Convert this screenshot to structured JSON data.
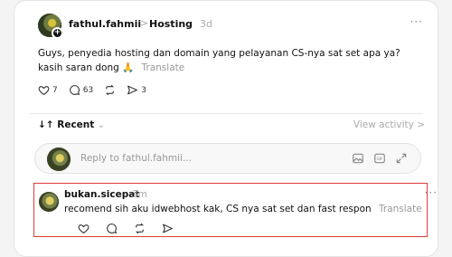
{
  "post": {
    "username": "fathul.fahmii",
    "separator": ">",
    "community": "Hosting",
    "time": "3d",
    "more": "···",
    "line1": "Guys, penyedia hosting dan domain yang pelayanan CS-nya sat set apa ya?",
    "line2": "kasih saran dong 🙏",
    "translate": "Translate",
    "likes": "7",
    "comments": "63",
    "shares": "3"
  },
  "sort": {
    "label": "↓↑ Recent",
    "caret": "⌄",
    "view_activity": "View activity >"
  },
  "reply": {
    "placeholder": "Reply to fathul.fahmii..."
  },
  "comment": {
    "username": "bukan.sicepat",
    "time": "3m",
    "text": "recomend sih aku idwebhost kak, CS nya sat set dan fast respon",
    "translate": "Translate",
    "more": "···"
  },
  "colors": {
    "highlight_border": "#e03a3a",
    "muted": "#aaaaaa"
  },
  "icons": [
    "heart-icon",
    "comment-icon",
    "repost-icon",
    "share-icon",
    "image-icon",
    "gif-icon",
    "expand-icon"
  ]
}
